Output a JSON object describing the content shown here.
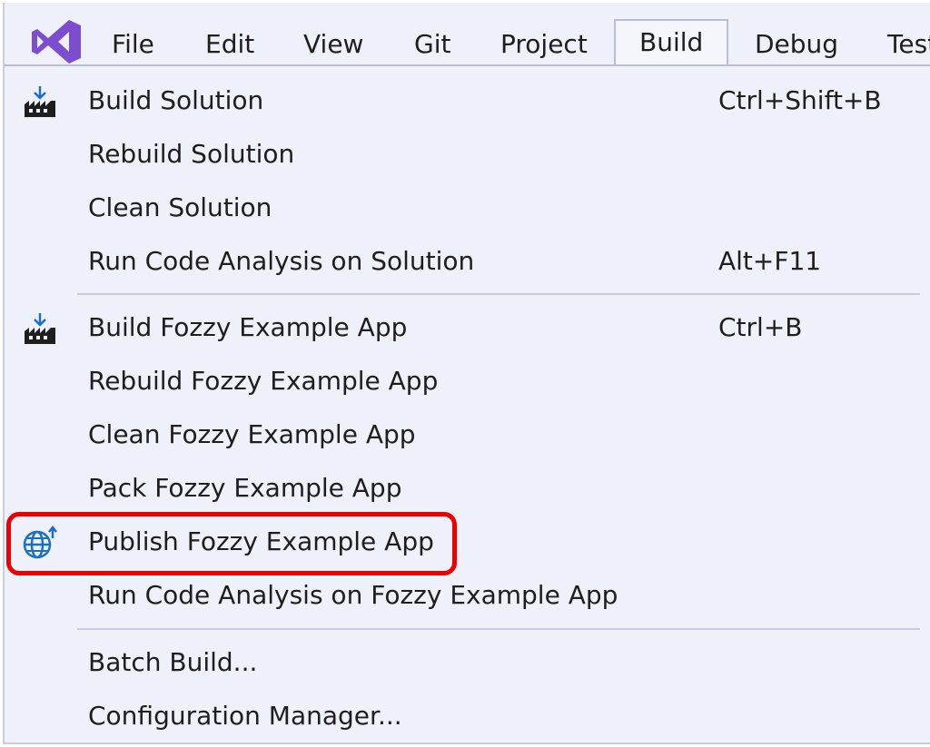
{
  "menubar": {
    "logo_icon": "visual-studio-logo-icon",
    "items": [
      {
        "label": "File"
      },
      {
        "label": "Edit"
      },
      {
        "label": "View"
      },
      {
        "label": "Git"
      },
      {
        "label": "Project"
      },
      {
        "label": "Build",
        "active": true
      },
      {
        "label": "Debug"
      },
      {
        "label": "Test"
      }
    ]
  },
  "build_menu": {
    "group1": [
      {
        "label": "Build Solution",
        "shortcut": "Ctrl+Shift+B",
        "icon": "build-icon"
      },
      {
        "label": "Rebuild Solution",
        "shortcut": ""
      },
      {
        "label": "Clean Solution",
        "shortcut": ""
      },
      {
        "label": "Run Code Analysis on Solution",
        "shortcut": "Alt+F11"
      }
    ],
    "group2": [
      {
        "label": "Build Fozzy Example App",
        "shortcut": "Ctrl+B",
        "icon": "build-icon"
      },
      {
        "label": "Rebuild Fozzy Example App",
        "shortcut": ""
      },
      {
        "label": "Clean Fozzy Example App",
        "shortcut": ""
      },
      {
        "label": "Pack Fozzy Example App",
        "shortcut": ""
      },
      {
        "label": "Publish Fozzy Example App",
        "shortcut": "",
        "icon": "publish-globe-icon",
        "highlighted": true
      },
      {
        "label": "Run Code Analysis on Fozzy Example App",
        "shortcut": ""
      }
    ],
    "group3": [
      {
        "label": "Batch Build...",
        "shortcut": ""
      },
      {
        "label": "Configuration Manager...",
        "shortcut": ""
      }
    ]
  },
  "colors": {
    "background": "#eef0fa",
    "text": "#1e1e1e",
    "separator": "#c9cce0",
    "logo": "#7c4dcf",
    "highlight_border": "#ee0000",
    "publish_icon": "#1a6fc7"
  }
}
